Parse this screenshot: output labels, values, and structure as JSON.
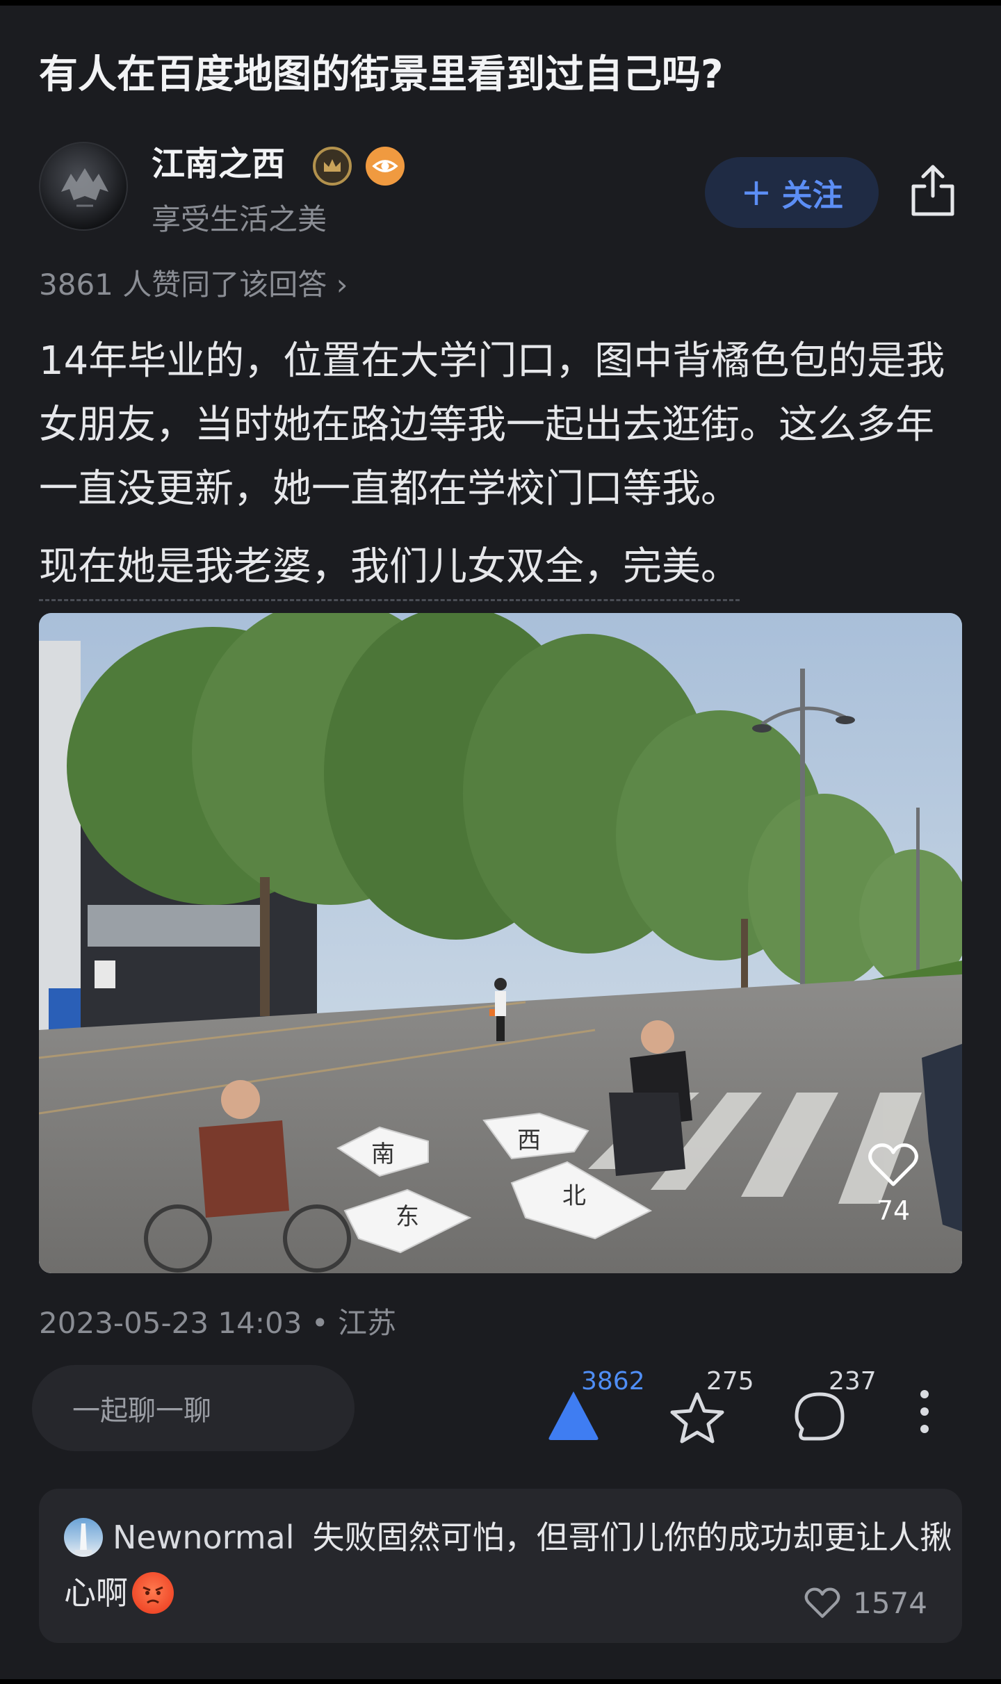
{
  "question": {
    "title": "有人在百度地图的街景里看到过自己吗?"
  },
  "author": {
    "name": "江南之西",
    "bio": "享受生活之美",
    "follow_label": "关注",
    "badges": [
      "crown-badge-icon",
      "eye-badge-icon"
    ]
  },
  "answer": {
    "likes_summary": "3861 人赞同了该回答 ›",
    "paragraph1": "14年毕业的，位置在大学门口，图中背橘色包的是我女朋友，当时她在路边等我一起出去逛街。这么多年一直没更新，她一直都在学校门口等我。",
    "paragraph2": "现在她是我老婆，我们儿女双全，完美。",
    "photo": {
      "arrow_labels": [
        "南",
        "西",
        "东",
        "北"
      ],
      "like_count": "74"
    },
    "meta": "2023-05-23 14:03 • 江苏"
  },
  "actions": {
    "chat_placeholder": "一起聊一聊",
    "upvote_count": "3862",
    "favorite_count": "275",
    "comment_count": "237"
  },
  "top_comment": {
    "user": "Newnormal",
    "text_line1": "失败固然可怕，但哥们儿你的成功却更让人揪",
    "text_line2": "心啊",
    "like_count": "1574"
  },
  "colors": {
    "background": "#1b1c20",
    "accent": "#5c8ef5",
    "upvote": "#3f7df2",
    "card": "#26272c"
  }
}
